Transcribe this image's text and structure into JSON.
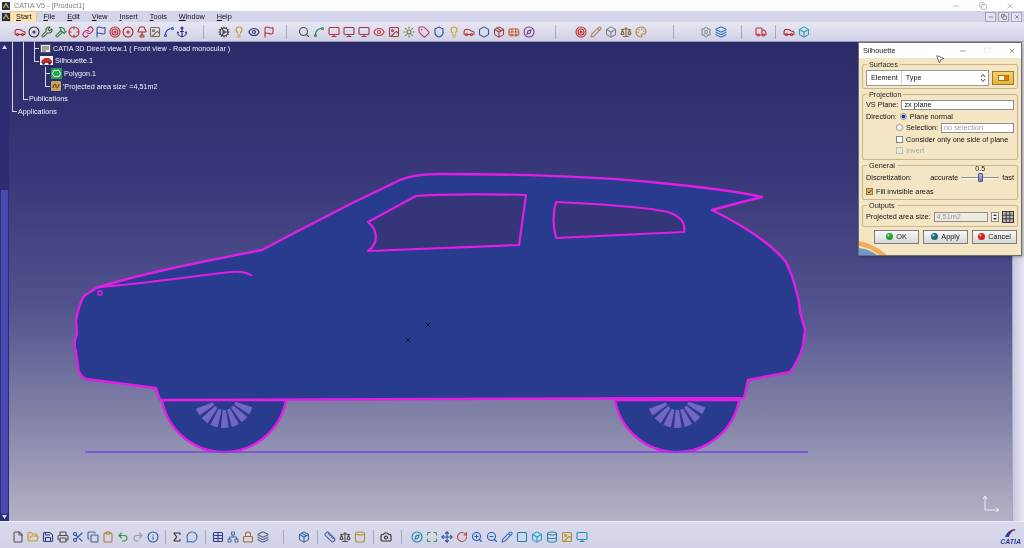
{
  "window": {
    "title": "CATIA V5 - [Product1]"
  },
  "menu": [
    {
      "label": "Start",
      "selected": true
    },
    {
      "label": "File",
      "selected": false
    },
    {
      "label": "Edit",
      "selected": false
    },
    {
      "label": "View",
      "selected": false
    },
    {
      "label": "Insert",
      "selected": false
    },
    {
      "label": "Tools",
      "selected": false
    },
    {
      "label": "Window",
      "selected": false
    },
    {
      "label": "Help",
      "selected": false
    }
  ],
  "tree": [
    {
      "children": [
        {
          "children": [
            {
              "label": "CATIA 3D Direct view.1 ( Front view - Road monocular )",
              "kind": "view"
            },
            {
              "label": "Silhouette.1",
              "kind": "silhouette",
              "children": [
                {
                  "label": "Polygon.1",
                  "kind": "polygon"
                },
                {
                  "label": "'Projected area size' =4,51m2",
                  "kind": "parameter"
                }
              ]
            }
          ]
        },
        {
          "label": "Publications"
        }
      ]
    },
    {
      "label": "Applications"
    }
  ],
  "dialog": {
    "title": "Silhouette",
    "surfaces": {
      "label": "Surfaces",
      "columns": [
        "Element",
        "Type"
      ]
    },
    "projection": {
      "label": "Projection",
      "plane": {
        "label": "VS Plane:",
        "value": "zx plane"
      },
      "direction_label": "Direction:",
      "directions": [
        {
          "label": "Plane normal",
          "selected": true
        },
        {
          "label": "Selection:",
          "selected": false
        }
      ],
      "selection": {
        "placeholder": "no selection"
      },
      "options": [
        {
          "label": "Consider only one side of plane",
          "checked": false,
          "disabled": false
        },
        {
          "label": "Invert",
          "checked": false,
          "disabled": true
        }
      ]
    },
    "general": {
      "label": "General",
      "discretization": {
        "label": "Discretization:",
        "min_label": "accurate",
        "max_label": "fast",
        "reading": "0.5",
        "level": 0.5
      },
      "fill_invisible": {
        "label": "Fill invisible areas",
        "checked": true
      }
    },
    "outputs": {
      "label": "Outputs",
      "area": {
        "label": "Projected area size:",
        "value": "4,51m2",
        "disabled": true
      }
    },
    "buttons": [
      {
        "label": "OK",
        "kind": "ok"
      },
      {
        "label": "Apply",
        "kind": "apply"
      },
      {
        "label": "Cancel",
        "kind": "cancel"
      }
    ]
  },
  "logo": {
    "text": "CATIA"
  }
}
